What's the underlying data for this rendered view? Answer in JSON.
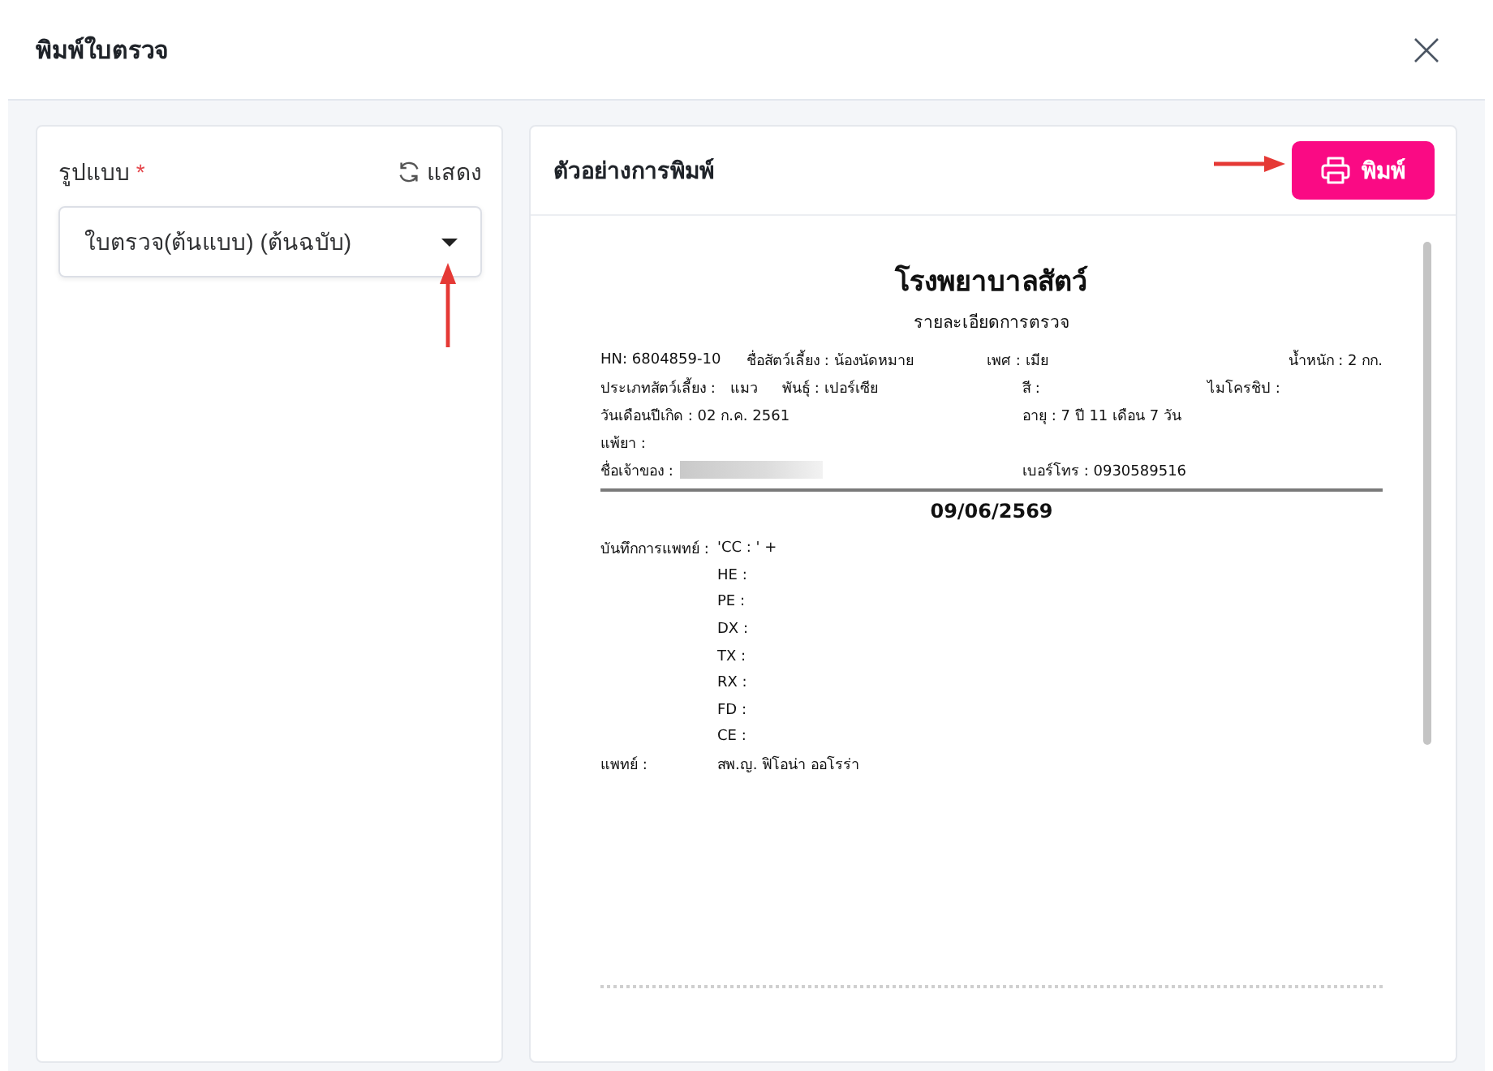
{
  "window": {
    "title": "พิมพ์ใบตรวจ"
  },
  "format_panel": {
    "label": "รูปแบบ",
    "required_mark": "*",
    "refresh_label": "แสดง",
    "select": {
      "value": "ใบตรวจ(ต้นแบบ) (ต้นฉบับ)"
    }
  },
  "preview_panel": {
    "title": "ตัวอย่างการพิมพ์",
    "print_button": "พิมพ์",
    "document": {
      "title": "โรงพยาบาลสัตว์",
      "subtitle": "รายละเอียดการตรวจ",
      "info_rows": [
        [
          {
            "text": "HN: 6804859-10",
            "redacted": false
          },
          {
            "text": "ชื่อสัตว์เลี้ยง : น้องนัดหมาย",
            "redacted": false
          },
          {
            "text": "เพศ : เมีย",
            "redacted": false
          },
          {
            "text": "น้ำหนัก : 2 กก.",
            "redacted": false
          }
        ],
        [
          {
            "text": "ประเภทสัตว์เลี้ยง :",
            "redacted": false
          },
          {
            "text": "แมว",
            "redacted": false
          },
          {
            "text": "พันธุ์ : เปอร์เซีย",
            "redacted": false
          },
          {
            "text": "สี :",
            "redacted": false
          },
          {
            "text": "ไมโครชิป :",
            "redacted": false
          }
        ],
        [
          {
            "text": "วันเดือนปีเกิด : 02 ก.ค. 2561",
            "redacted": false
          },
          {
            "text": "อายุ : 7 ปี 11 เดือน 7 วัน",
            "redacted": false
          }
        ],
        [
          {
            "text": "แพ้ยา :",
            "redacted": false
          }
        ],
        [
          {
            "text": "ชื่อเจ้าของ :",
            "redacted": true
          },
          {
            "text": "เบอร์โทร : 0930589516",
            "redacted": false
          }
        ]
      ],
      "date": "09/06/2569",
      "notes": [
        {
          "label": "บันทึกการแพทย์ :",
          "value": "'CC : ' +"
        },
        {
          "value": "HE :"
        },
        {
          "value": "PE :"
        },
        {
          "value": "DX :"
        },
        {
          "value": "TX :"
        },
        {
          "value": "RX :"
        },
        {
          "value": "FD :"
        },
        {
          "value": "CE :"
        },
        {
          "label": "แพทย์ :",
          "value": "สพ.ญ. ฟิโอน่า ออโรร่า"
        }
      ]
    }
  }
}
